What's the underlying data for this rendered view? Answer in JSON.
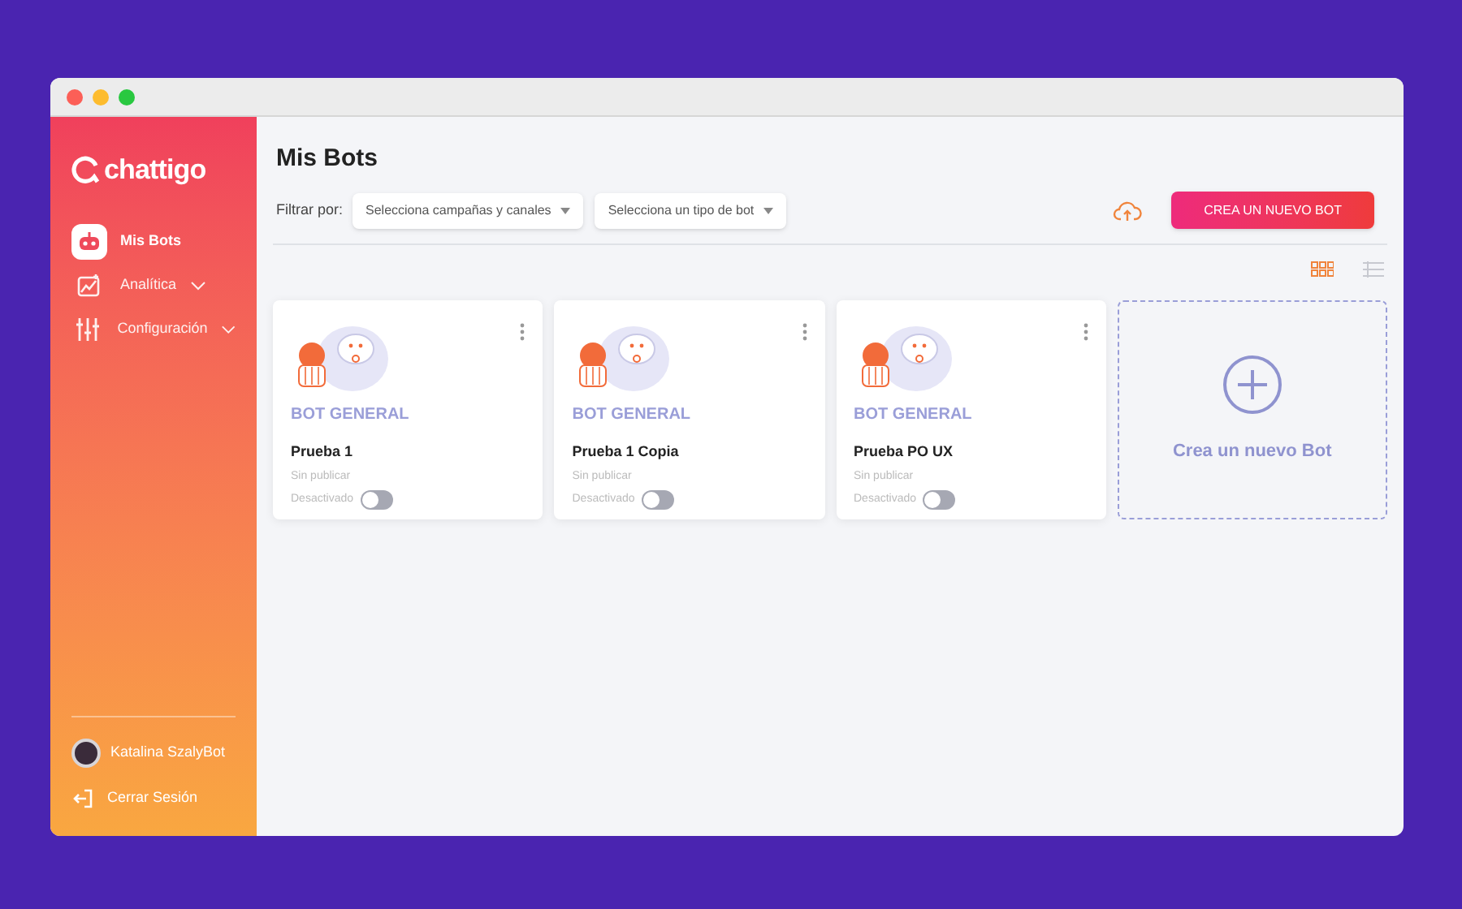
{
  "logo": {
    "text": "chattigo"
  },
  "nav": [
    {
      "label": "Mis Bots",
      "kind": "robot",
      "selected": true,
      "expandable": false
    },
    {
      "label": "Analítica",
      "kind": "chart",
      "selected": false,
      "expandable": true
    },
    {
      "label": "Configuración",
      "kind": "sliders",
      "selected": false,
      "expandable": true
    }
  ],
  "user": {
    "name": "Katalina SzalyBot"
  },
  "logout": {
    "label": "Cerrar Sesión"
  },
  "page_title": "Mis Bots",
  "filters": {
    "label": "Filtrar por:",
    "selects": [
      {
        "placeholder": "Selecciona campañas y canales"
      },
      {
        "placeholder": "Selecciona un tipo de bot"
      }
    ]
  },
  "create_button": "CREA UN NUEVO BOT",
  "views": [
    {
      "kind": "grid",
      "selected": true
    },
    {
      "kind": "list",
      "selected": false
    }
  ],
  "bots": [
    {
      "type": "BOT GENERAL",
      "name": "Prueba 1",
      "status": "Sin publicar",
      "toggle_label": "Desactivado",
      "on": false
    },
    {
      "type": "BOT GENERAL",
      "name": "Prueba 1 Copia",
      "status": "Sin publicar",
      "toggle_label": "Desactivado",
      "on": false
    },
    {
      "type": "BOT GENERAL",
      "name": "Prueba PO UX",
      "status": "Sin publicar",
      "toggle_label": "Desactivado",
      "on": false
    }
  ],
  "new_bot_card": {
    "label": "Crea un nuevo Bot"
  }
}
